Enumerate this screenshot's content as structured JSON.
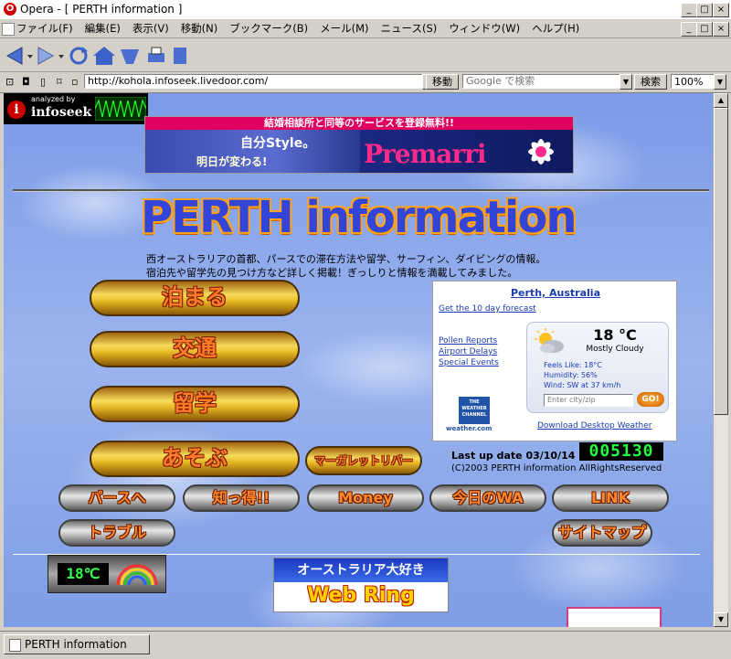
{
  "window": {
    "title": "Opera - [ PERTH information ]",
    "minimize": "_",
    "maximize": "□",
    "close": "×"
  },
  "menu": [
    "ファイル(F)",
    "編集(E)",
    "表示(V)",
    "移動(N)",
    "ブックマーク(B)",
    "メール(M)",
    "ニュース(S)",
    "ウィンドウ(W)",
    "ヘルプ(H)"
  ],
  "address": {
    "url": "http://kohola.infoseek.livedoor.com/",
    "go_label": "移動",
    "search_placeholder": "Google で検索",
    "search_label": "検索",
    "zoom": "100%"
  },
  "page": {
    "infoseek_top": "analyzed by",
    "infoseek_logo": "infoseek",
    "banner_top": "結婚相談所と同等のサービスを登録無料!!",
    "banner_style": "自分Style。",
    "banner_tomorrow": "明日が変わる!",
    "banner_brand": "Premarri",
    "site_title": "PERTH information",
    "intro_line1": "西オーストラリアの首都、パースでの滞在方法や留学、サーフィン、ダイビングの情報。",
    "intro_line2": "宿泊先や留学先の見つけ方など詳しく掲載！ぎっしりと情報を満載してみました。",
    "main_buttons": [
      "泊まる",
      "交通",
      "留学",
      "あそぶ"
    ],
    "margaret_button": "マーガレットリバー",
    "last_update": "Last up date 03/10/14",
    "counter": "005130",
    "copyright": "(C)2003 PERTH information AllRightsReserved",
    "nav_buttons": [
      "パースへ",
      "知っ得!!",
      "Money",
      "今日のWA",
      "LINK"
    ],
    "trouble_button": "トラブル",
    "sitemap_button": "サイトマップ",
    "mini_temp": "18℃",
    "webring_top": "オーストラリア大好き",
    "webring_bottom": "Web Ring"
  },
  "weather": {
    "location": "Perth, Australia",
    "forecast_link": "Get the 10 day forecast",
    "links": [
      "Pollen Reports",
      "Airport Delays",
      "Special Events"
    ],
    "temp": "18 °C",
    "condition": "Mostly Cloudy",
    "feels_like": "Feels Like: 18°C",
    "humidity": "Humidity: 56%",
    "wind": "Wind: SW at 37 km/h",
    "input_placeholder": "Enter city/zip",
    "go": "GO!",
    "logo_line1": "THE",
    "logo_line2": "WEATHER",
    "logo_line3": "CHANNEL",
    "logo_site": "weather.com",
    "download": "Download Desktop Weather"
  },
  "status": {
    "tab": "PERTH information"
  }
}
